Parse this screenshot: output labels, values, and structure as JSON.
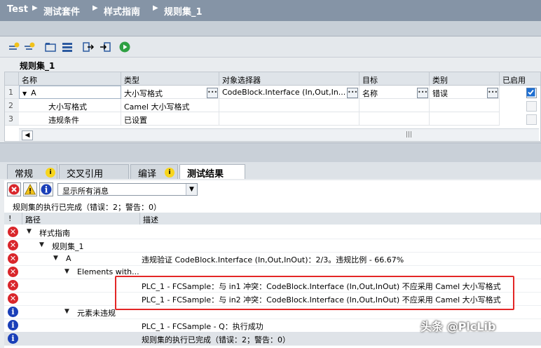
{
  "breadcrumb": [
    "Test",
    "测试套件",
    "样式指南",
    "规则集_1"
  ],
  "ruleset_title": "规则集_1",
  "grid": {
    "headers": [
      "名称",
      "类型",
      "对象选择器",
      "目标",
      "类别",
      "已启用"
    ],
    "rows": [
      {
        "num": "1",
        "name": "A",
        "type": "大小写格式",
        "selector": "CodeBlock.Interface (In,Out,In...",
        "target": "名称",
        "category": "错误",
        "enabled": true
      },
      {
        "num": "2",
        "name": "大小写格式",
        "type": "Camel 大小写格式",
        "enabled": false
      },
      {
        "num": "3",
        "name": "违规条件",
        "type": "已设置",
        "enabled": false
      }
    ]
  },
  "tabs": [
    {
      "label": "常规",
      "badge": "i"
    },
    {
      "label": "交叉引用",
      "badge": ""
    },
    {
      "label": "编译",
      "badge": "i"
    },
    {
      "label": "测试结果",
      "badge": ""
    }
  ],
  "filter": {
    "selected": "显示所有消息"
  },
  "status_text": "规则集的执行已完成（错误：2；警告：0）",
  "list": {
    "headers": [
      "!",
      "路径",
      "描述"
    ],
    "rows": [
      {
        "icon": "error",
        "path": "样式指南",
        "desc": ""
      },
      {
        "icon": "error",
        "path": "规则集_1",
        "desc": ""
      },
      {
        "icon": "error",
        "path": "A",
        "desc": "违规验证 CodeBlock.Interface (In,Out,InOut)：2/3。违规比例 - 66.67%"
      },
      {
        "icon": "error",
        "path": "Elements with...",
        "desc": ""
      },
      {
        "icon": "error",
        "path": "",
        "desc": "PLC_1 - FCSample：与 in1 冲突：CodeBlock.Interface (In,Out,InOut) 不应采用 Camel 大小写格式"
      },
      {
        "icon": "error",
        "path": "",
        "desc": "PLC_1 - FCSample：与 in2 冲突：CodeBlock.Interface (In,Out,InOut) 不应采用 Camel 大小写格式"
      },
      {
        "icon": "info",
        "path": "元素未违规",
        "desc": ""
      },
      {
        "icon": "info",
        "path": "",
        "desc": "PLC_1 - FCSample - Q：执行成功"
      },
      {
        "icon": "info",
        "path": "",
        "desc": "规则集的执行已完成（错误：2；警告：0）"
      }
    ]
  },
  "watermark": "头条 @PlcLib",
  "colors": {
    "title_bg": "#8594a6",
    "error": "#d9262b",
    "info": "#1a3fb8",
    "highlight": "#e32626"
  }
}
